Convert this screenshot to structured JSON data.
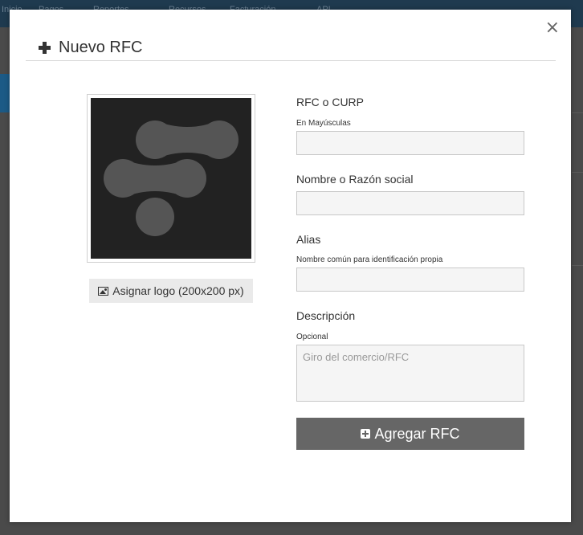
{
  "background": {
    "nav_items": [
      "Inicio",
      "Pagos",
      "Reportes",
      "Recursos",
      "Facturación",
      "API"
    ]
  },
  "modal": {
    "title": "Nuevo RFC",
    "close_label": "×",
    "logo": {
      "icon": "brand-logo",
      "assign_button_label": "Asignar logo (200x200 px)"
    },
    "form": {
      "rfc": {
        "label": "RFC o CURP",
        "hint": "En Mayúsculas",
        "value": "",
        "placeholder": ""
      },
      "name": {
        "label": "Nombre o Razón social",
        "value": "",
        "placeholder": ""
      },
      "alias": {
        "label": "Alias",
        "hint": "Nombre común para identificación propia",
        "value": "",
        "placeholder": ""
      },
      "description": {
        "label": "Descripción",
        "hint": "Opcional",
        "value": "",
        "placeholder": "Giro del comercio/RFC"
      },
      "submit_label": "Agregar RFC"
    }
  },
  "colors": {
    "overlay": "#4a4a4a",
    "modal_bg": "#ffffff",
    "logo_bg": "#222222",
    "logo_shape": "#555555",
    "submit_bg": "#666666"
  }
}
